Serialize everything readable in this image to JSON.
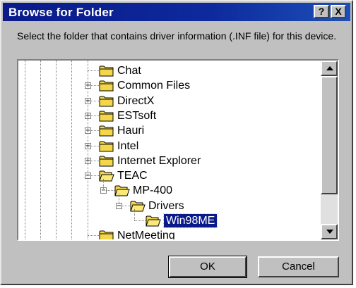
{
  "window": {
    "title": "Browse for Folder",
    "help_label": "?",
    "close_label": "X"
  },
  "instruction": "Select the folder that contains driver information (.INF file) for this device.",
  "tree": {
    "items": [
      {
        "label": "Chat",
        "expander": ""
      },
      {
        "label": "Common Files",
        "expander": "+"
      },
      {
        "label": "DirectX",
        "expander": "+"
      },
      {
        "label": "ESTsoft",
        "expander": "+"
      },
      {
        "label": "Hauri",
        "expander": "+"
      },
      {
        "label": "Intel",
        "expander": "+"
      },
      {
        "label": "Internet Explorer",
        "expander": "+"
      },
      {
        "label": "TEAC",
        "expander": "−"
      },
      {
        "label": "MP-400",
        "expander": "−"
      },
      {
        "label": "Drivers",
        "expander": "−"
      },
      {
        "label": "Win98ME",
        "expander": "",
        "selected": true
      },
      {
        "label": "NetMeeting",
        "expander": ""
      }
    ]
  },
  "buttons": {
    "ok": "OK",
    "cancel": "Cancel"
  },
  "colors": {
    "titlebar": "#0a1a8a",
    "face": "#c0c0c0",
    "selection": "#0a1a8a",
    "folder": "#f4d64a"
  }
}
